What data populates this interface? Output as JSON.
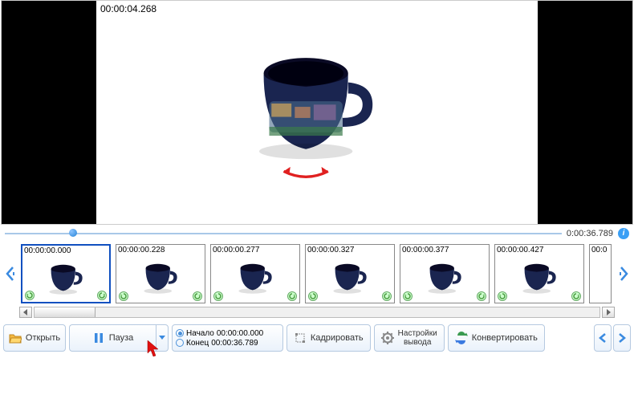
{
  "viewer": {
    "timecode": "00:00:04.268"
  },
  "timeline": {
    "duration": "0:00:36.789",
    "position_pct": 11.6
  },
  "frames": [
    {
      "time": "00:00:00.000",
      "selected": true
    },
    {
      "time": "00:00:00.228",
      "selected": false
    },
    {
      "time": "00:00:00.277",
      "selected": false
    },
    {
      "time": "00:00:00.327",
      "selected": false
    },
    {
      "time": "00:00:00.377",
      "selected": false
    },
    {
      "time": "00:00:00.427",
      "selected": false
    },
    {
      "time": "00:0",
      "selected": false,
      "cut": true
    }
  ],
  "toolbar": {
    "open": "Открыть",
    "pause": "Пауза",
    "start_label": "Начало",
    "start_value": "00:00:00.000",
    "end_label": "Конец",
    "end_value": "00:00:36.789",
    "crop": "Кадрировать",
    "settings_line1": "Настройки",
    "settings_line2": "вывода",
    "convert": "Конвертировать"
  }
}
